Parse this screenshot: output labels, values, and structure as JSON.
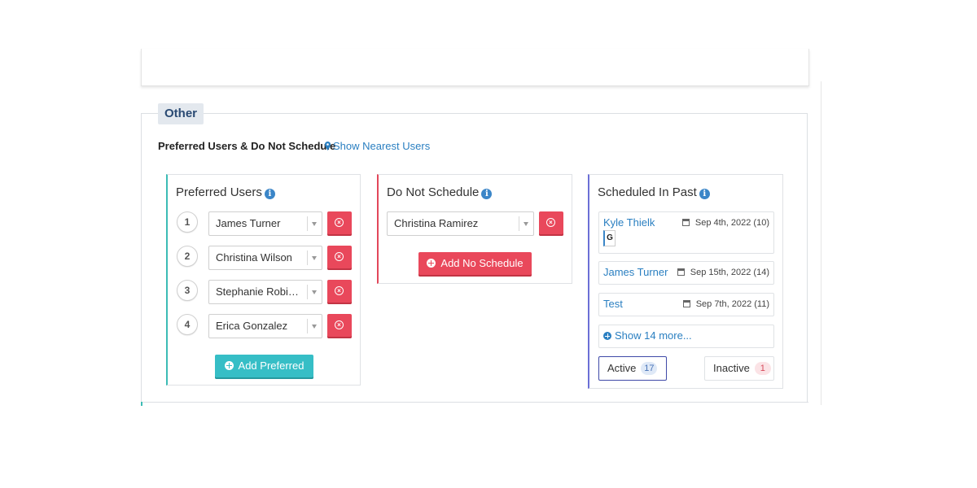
{
  "section": {
    "legend": "Other",
    "title": "Preferred Users & Do Not Schedule",
    "nearest_link": "Show Nearest Users"
  },
  "preferred": {
    "title": "Preferred Users",
    "users": [
      {
        "rank": "1",
        "name": "James Turner"
      },
      {
        "rank": "2",
        "name": "Christina Wilson"
      },
      {
        "rank": "3",
        "name": "Stephanie Robin…"
      },
      {
        "rank": "4",
        "name": "Erica Gonzalez"
      }
    ],
    "add_label": "Add Preferred"
  },
  "do_not_schedule": {
    "title": "Do Not Schedule",
    "users": [
      {
        "name": "Christina Ramirez"
      }
    ],
    "add_label": "Add No Schedule"
  },
  "scheduled_past": {
    "title": "Scheduled In Past",
    "items": [
      {
        "name": "Kyle Thielk",
        "date": "Sep 4th, 2022 (10)",
        "badge": "G"
      },
      {
        "name": "James Turner",
        "date": "Sep 15th, 2022 (14)"
      },
      {
        "name": "Test",
        "date": "Sep 7th, 2022 (11)"
      }
    ],
    "show_more": "Show 14 more...",
    "tabs": {
      "active_label": "Active",
      "active_count": "17",
      "inactive_label": "Inactive",
      "inactive_count": "1"
    }
  },
  "colors": {
    "preferred_accent": "#3cbcb5",
    "dns_accent": "#e2475a",
    "past_accent": "#6b6fd6",
    "link": "#2a7fc1"
  }
}
